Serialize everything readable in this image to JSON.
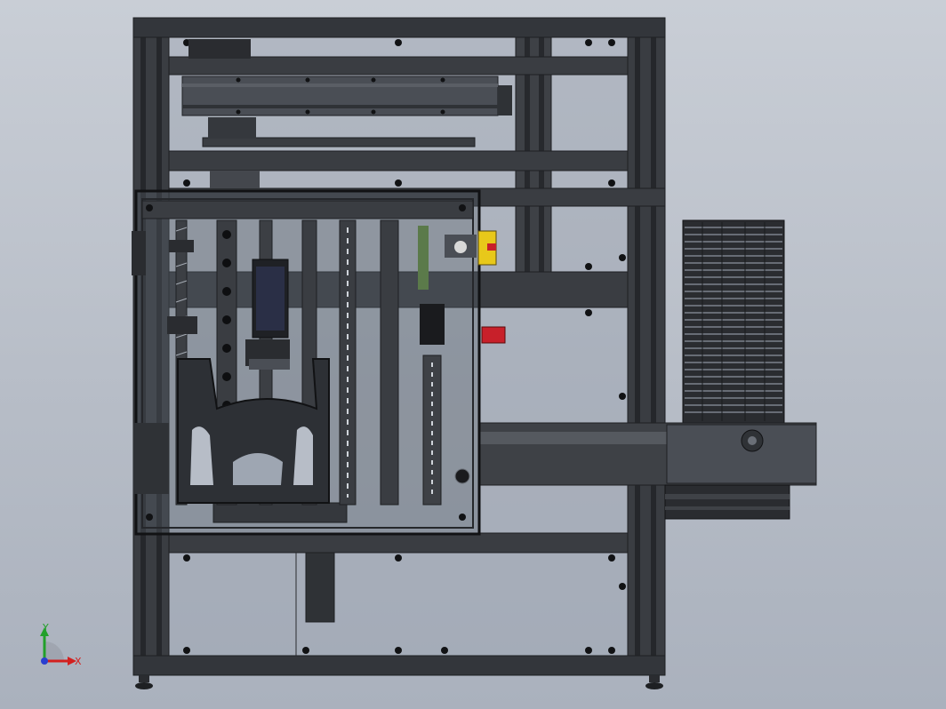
{
  "viewport": {
    "background_top": "#c9ced6",
    "background_bottom": "#aab1bd"
  },
  "model": {
    "frame_color": "#3a3d42",
    "frame_dark": "#1e2023",
    "panel_color": "#4a4e55",
    "glass_color": "#9ea6b2",
    "accent_red": "#c8202a",
    "accent_yellow": "#e8c81a"
  },
  "triad": {
    "x_label": "X",
    "y_label": "Y",
    "x_color": "#d3201f",
    "y_color": "#22a02a",
    "z_color": "#2a3fd0"
  }
}
